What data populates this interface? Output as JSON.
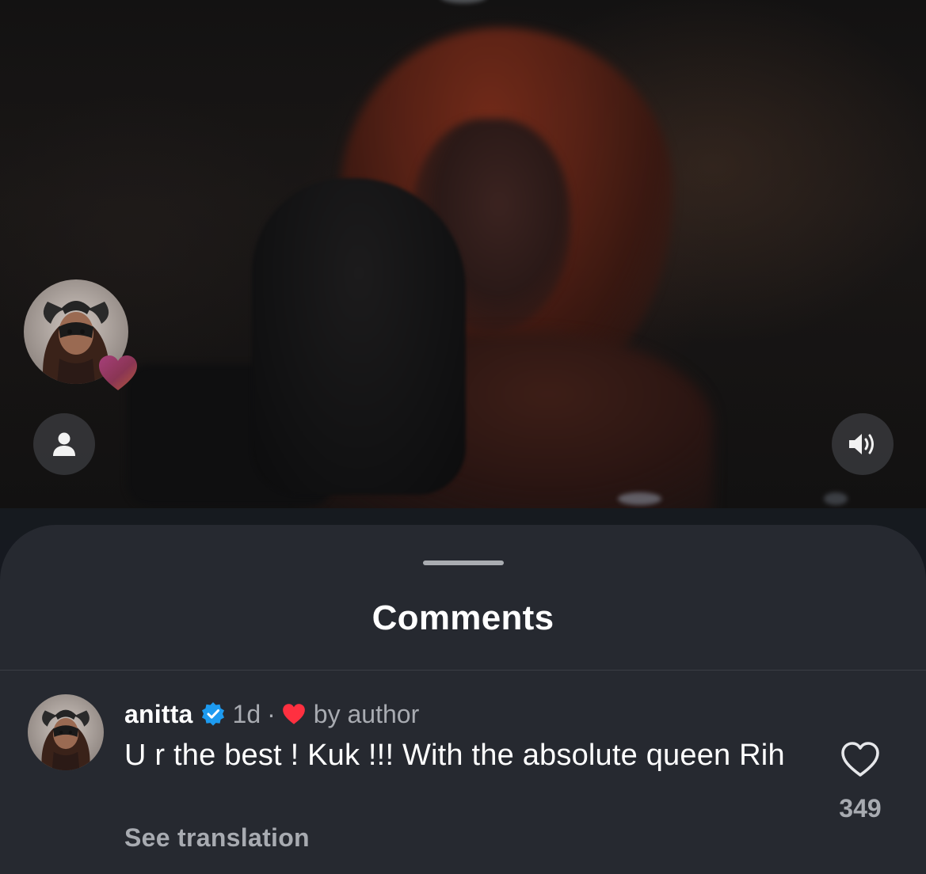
{
  "video": {
    "avatar_icon": "profile-avatar-icon",
    "reaction_icon": "gradient-heart-icon",
    "user_button_icon": "person-icon",
    "volume_button_icon": "speaker-icon"
  },
  "sheet": {
    "title": "Comments"
  },
  "comment": {
    "username": "anitta",
    "verified_icon": "verified-badge-icon",
    "time": "1d",
    "separator": "·",
    "author_like_icon": "red-heart-icon",
    "author_like_label": "by author",
    "text": "U r the best ! Kuk !!! With the absolute queen Rih",
    "translation_label": "See translation",
    "like_count": "349",
    "like_icon": "heart-outline-icon"
  },
  "colors": {
    "sheet_background": "#262930",
    "text_primary": "#ffffff",
    "text_secondary": "#a8abb1",
    "verified_blue": "#1d9bf0",
    "author_heart_red": "#ff3040"
  }
}
